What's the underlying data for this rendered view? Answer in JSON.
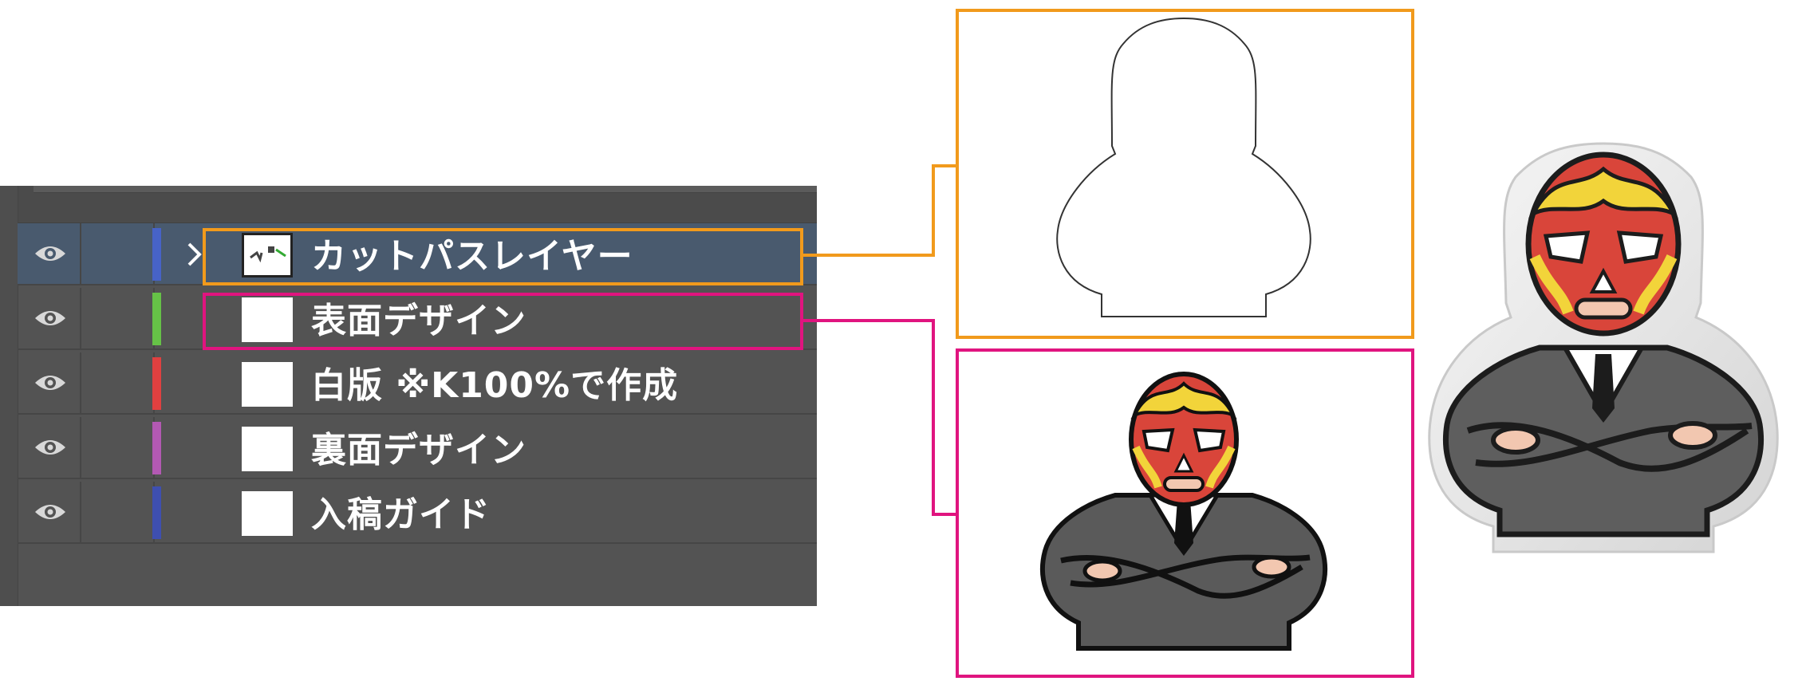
{
  "colors": {
    "orange": "#f19a1c",
    "magenta": "#e0147f",
    "panel_bg": "#535353",
    "selected_row": "#495a6e"
  },
  "layers_panel": {
    "layers": [
      {
        "name": "カットパスレイヤー",
        "color": "#4763c7",
        "selected": true,
        "expandable": true,
        "highlight": "orange"
      },
      {
        "name": "表面デザイン",
        "color": "#66c247",
        "selected": false,
        "expandable": false,
        "highlight": "magenta"
      },
      {
        "name": "白版 ※K100%で作成",
        "color": "#e04040",
        "selected": false,
        "expandable": false,
        "highlight": ""
      },
      {
        "name": "裏面デザイン",
        "color": "#b359b3",
        "selected": false,
        "expandable": false,
        "highlight": ""
      },
      {
        "name": "入稿ガイド",
        "color": "#3e4fb0",
        "selected": false,
        "expandable": false,
        "highlight": ""
      }
    ],
    "icons": {
      "visibility": "eye-icon",
      "expand": "chevron-right-icon"
    }
  },
  "previews": {
    "cut_path": {
      "label": "cut-path-outline",
      "border_color": "#f19a1c"
    },
    "front_design": {
      "label": "luchador-illustration",
      "border_color": "#e0147f"
    }
  },
  "product_photo": {
    "label": "acrylic-stand-photo"
  }
}
